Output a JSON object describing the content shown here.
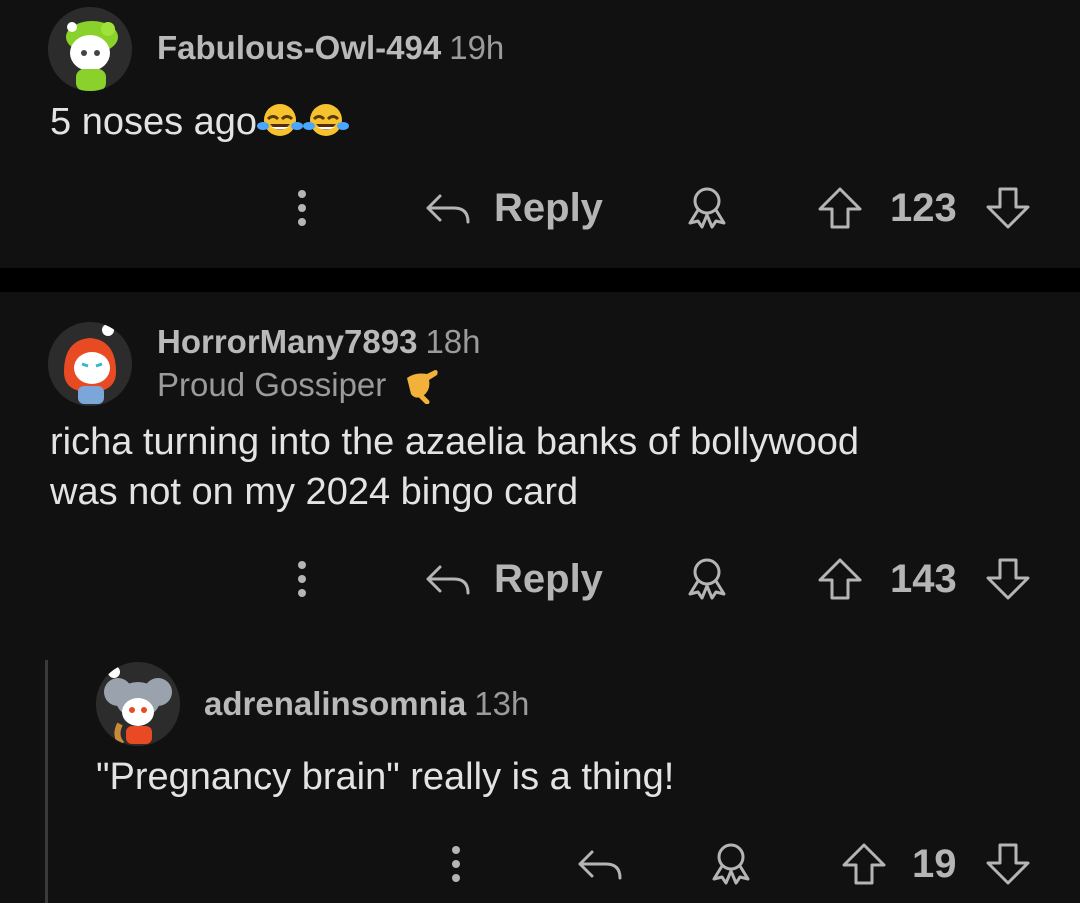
{
  "comments": [
    {
      "username": "Fabulous-Owl-494",
      "time": "19h",
      "body_text": "5 noses ago",
      "body_emoji": [
        "tears-of-joy-icon",
        "tears-of-joy-icon"
      ],
      "reply_label": "Reply",
      "votes": "123"
    },
    {
      "username": "HorrorMany7893",
      "time": "18h",
      "flair": "Proud Gossiper",
      "flair_icon": "hand-pointing-icon",
      "body_line1": "richa turning into the azaelia banks of bollywood",
      "body_line2": "was not on my 2024 bingo card",
      "reply_label": "Reply",
      "votes": "143"
    },
    {
      "username": "adrenalinsomnia",
      "time": "13h",
      "body_text": "\"Pregnancy brain\" really is a thing!",
      "votes": "19"
    }
  ],
  "colors": {
    "background": "#111111",
    "divider": "#000000",
    "text": "#e3e3e3",
    "muted": "#9b9b9b"
  }
}
